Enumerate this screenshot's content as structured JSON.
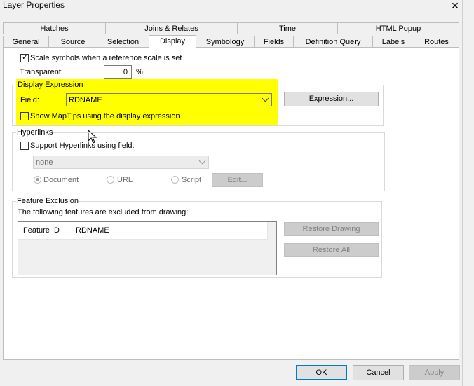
{
  "window": {
    "title": "Layer Properties",
    "close_glyph": "✕"
  },
  "tabs_top": [
    "Hatches",
    "Joins & Relates",
    "Time",
    "HTML Popup"
  ],
  "tabs_bottom": [
    "General",
    "Source",
    "Selection",
    "Display",
    "Symbology",
    "Fields",
    "Definition Query",
    "Labels",
    "Routes"
  ],
  "active_tab": "Display",
  "display": {
    "scale_symbols_label": "Scale symbols when a reference scale is set",
    "scale_symbols_checked": true,
    "transparent_label": "Transparent:",
    "transparent_value": "0",
    "transparent_unit": "%"
  },
  "display_expression": {
    "legend": "Display Expression",
    "field_label": "Field:",
    "field_value": "RDNAME",
    "expression_button": "Expression...",
    "maptips_label": "Show MapTips using the display expression",
    "highlight_color": "#ffff00"
  },
  "hyperlinks": {
    "legend": "Hyperlinks",
    "support_label": "Support Hyperlinks using field:",
    "field_value": "none",
    "radio_document": "Document",
    "radio_url": "URL",
    "radio_script": "Script",
    "edit_button": "Edit..."
  },
  "feature_exclusion": {
    "legend": "Feature Exclusion",
    "description": "The following features are excluded from drawing:",
    "columns": [
      "Feature ID",
      "RDNAME"
    ],
    "restore_drawing_button": "Restore Drawing",
    "restore_all_button": "Restore All"
  },
  "footer": {
    "ok": "OK",
    "cancel": "Cancel",
    "apply": "Apply"
  }
}
